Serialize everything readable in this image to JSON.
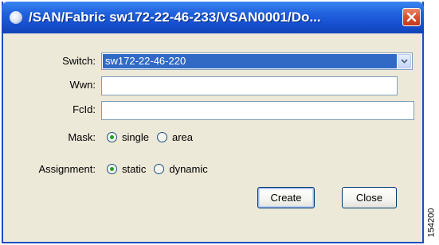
{
  "window": {
    "title": "/SAN/Fabric sw172-22-46-233/VSAN0001/Do..."
  },
  "form": {
    "switch_label": "Switch:",
    "switch_value": "sw172-22-46-220",
    "wwn_label": "Wwn:",
    "wwn_value": "",
    "fcid_label": "FcId:",
    "fcid_value": "",
    "mask_label": "Mask:",
    "mask_options": [
      {
        "label": "single",
        "selected": true
      },
      {
        "label": "area",
        "selected": false
      }
    ],
    "assignment_label": "Assignment:",
    "assignment_options": [
      {
        "label": "static",
        "selected": true
      },
      {
        "label": "dynamic",
        "selected": false
      }
    ]
  },
  "buttons": {
    "create_label": "Create",
    "close_label": "Close"
  },
  "figure_id": "154200",
  "icons": {
    "title": "app-icon",
    "close": "close-icon",
    "dropdown": "chevron-down-icon"
  },
  "colors": {
    "titlebar": "#2163df",
    "selection": "#316ac5",
    "close_button": "#d9512f",
    "radio_dot": "#21a121"
  }
}
